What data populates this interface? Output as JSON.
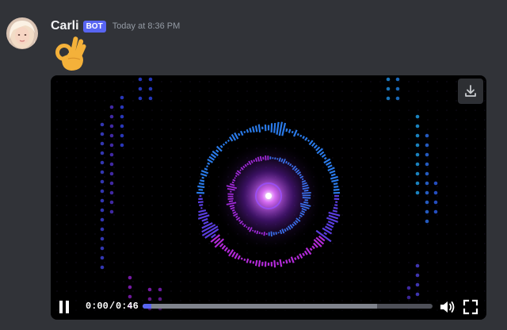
{
  "message": {
    "author": "Carli",
    "badge": "BOT",
    "timestamp": "Today at 8:36 PM",
    "emoji": "ok-hand"
  },
  "video": {
    "current_time": "0:00",
    "separator": "/",
    "duration": "0:46",
    "played_fraction": 0.03,
    "buffered_fraction": 0.81,
    "icons": {
      "download": "download-icon",
      "pause": "pause-icon",
      "volume": "volume-icon",
      "fullscreen": "fullscreen-icon"
    }
  }
}
